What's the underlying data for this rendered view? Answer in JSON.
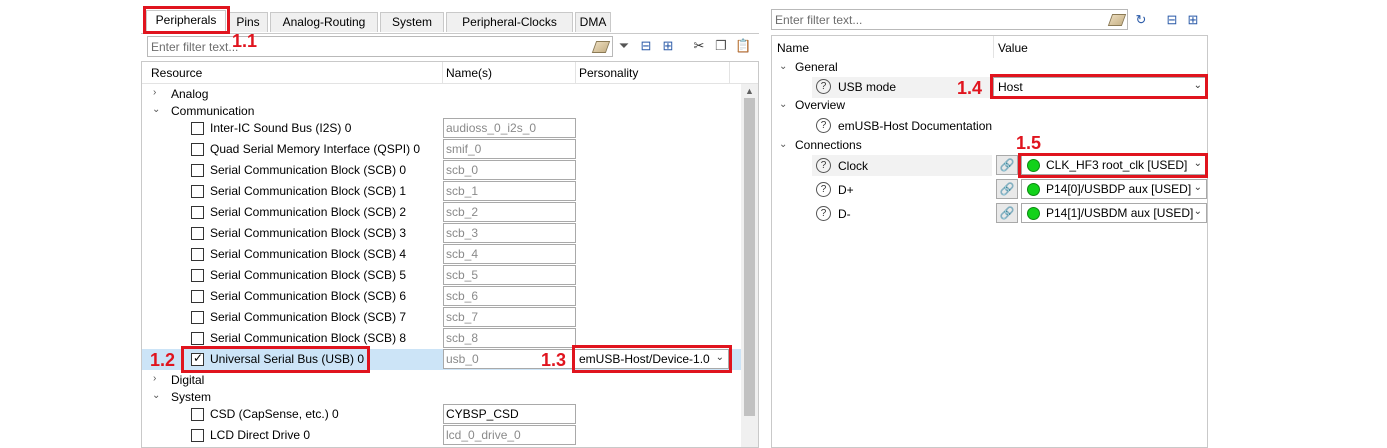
{
  "tabs": [
    "Peripherals",
    "Pins",
    "Analog-Routing",
    "System",
    "Peripheral-Clocks",
    "DMA"
  ],
  "left_filter_placeholder": "Enter filter text...",
  "right_filter_placeholder": "Enter filter text...",
  "columns": {
    "resource": "Resource",
    "names": "Name(s)",
    "personality": "Personality"
  },
  "tree": {
    "analog": "Analog",
    "communication": "Communication",
    "digital": "Digital",
    "system": "System"
  },
  "comm_items": [
    {
      "label": "Inter-IC Sound Bus (I2S) 0",
      "name": "audioss_0_i2s_0",
      "checked": false
    },
    {
      "label": "Quad Serial Memory Interface (QSPI) 0",
      "name": "smif_0",
      "checked": false
    },
    {
      "label": "Serial Communication Block (SCB) 0",
      "name": "scb_0",
      "checked": false
    },
    {
      "label": "Serial Communication Block (SCB) 1",
      "name": "scb_1",
      "checked": false
    },
    {
      "label": "Serial Communication Block (SCB) 2",
      "name": "scb_2",
      "checked": false
    },
    {
      "label": "Serial Communication Block (SCB) 3",
      "name": "scb_3",
      "checked": false
    },
    {
      "label": "Serial Communication Block (SCB) 4",
      "name": "scb_4",
      "checked": false
    },
    {
      "label": "Serial Communication Block (SCB) 5",
      "name": "scb_5",
      "checked": false
    },
    {
      "label": "Serial Communication Block (SCB) 6",
      "name": "scb_6",
      "checked": false
    },
    {
      "label": "Serial Communication Block (SCB) 7",
      "name": "scb_7",
      "checked": false
    },
    {
      "label": "Serial Communication Block (SCB) 8",
      "name": "scb_8",
      "checked": false
    },
    {
      "label": "Universal Serial Bus (USB) 0",
      "name": "usb_0",
      "checked": true,
      "personality": "emUSB-Host/Device-1.0"
    }
  ],
  "system_items": [
    {
      "label": "CSD (CapSense, etc.) 0",
      "name": "CYBSP_CSD",
      "checked": false
    },
    {
      "label": "LCD Direct Drive 0",
      "name": "lcd_0_drive_0",
      "checked": false
    }
  ],
  "right": {
    "col_name": "Name",
    "col_value": "Value",
    "general": "General",
    "usb_mode_label": "USB mode",
    "usb_mode_value": "Host",
    "overview": "Overview",
    "doc_label": "emUSB-Host Documentation",
    "connections": "Connections",
    "clock_label": "Clock",
    "clock_value": "CLK_HF3 root_clk [USED]",
    "dplus_label": "D+",
    "dplus_value": "P14[0]/USBDP aux [USED]",
    "dminus_label": "D-",
    "dminus_value": "P14[1]/USBDM aux [USED]"
  },
  "annotations": [
    "1.1",
    "1.2",
    "1.3",
    "1.4",
    "1.5"
  ],
  "colors": {
    "highlight": "#e0141e",
    "status_ok": "#12d21a",
    "selection": "#cce4f7"
  }
}
